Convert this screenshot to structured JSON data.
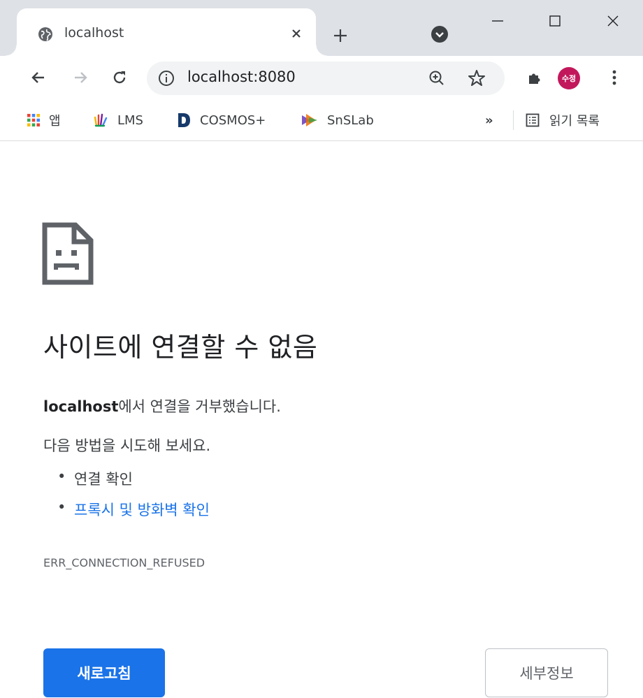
{
  "tab": {
    "title": "localhost",
    "favicon": "globe-icon"
  },
  "toolbar": {
    "url": "localhost:8080",
    "avatar_label": "수정",
    "avatar_color": "#c2185b"
  },
  "bookmarks": {
    "items": [
      {
        "label": "앱",
        "icon": "apps-grid-icon"
      },
      {
        "label": "LMS",
        "icon": "lms-hand-icon"
      },
      {
        "label": "COSMOS+",
        "icon": "cosmos-d-icon"
      },
      {
        "label": "SnSLab",
        "icon": "snslab-icon"
      }
    ],
    "overflow": "»",
    "reading_list": "읽기 목록"
  },
  "error": {
    "title": "사이트에 연결할 수 없음",
    "host": "localhost",
    "message_suffix": "에서 연결을 거부했습니다.",
    "try_label": "다음 방법을 시도해 보세요.",
    "suggestions": [
      "연결 확인",
      "프록시 및 방화벽 확인"
    ],
    "code": "ERR_CONNECTION_REFUSED",
    "reload_label": "새로고침",
    "details_label": "세부정보"
  },
  "colors": {
    "accent": "#1a73e8",
    "tabstrip": "#dee1e6",
    "omnibox": "#f1f3f4"
  }
}
